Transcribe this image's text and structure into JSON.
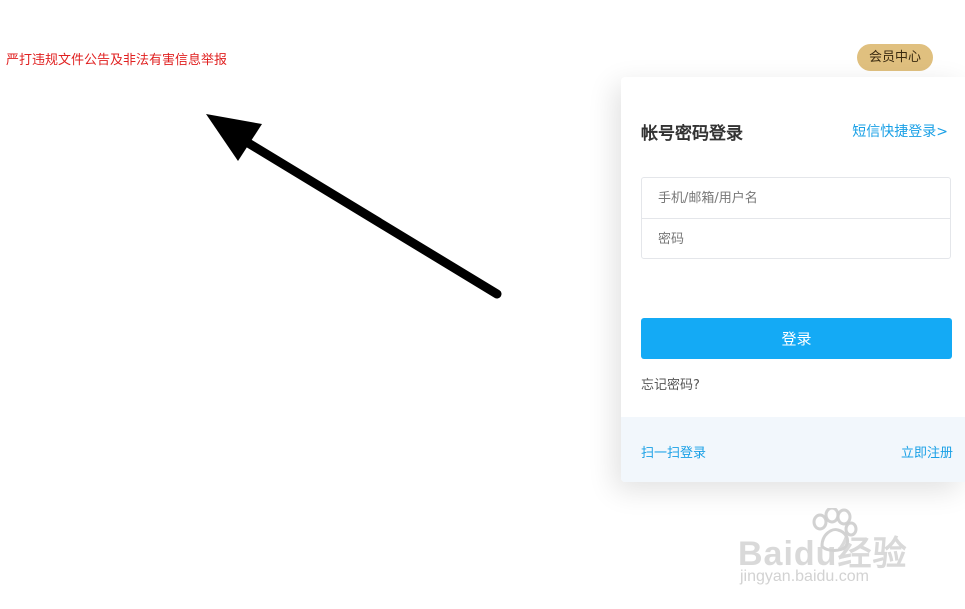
{
  "top": {
    "notice_link": "严打违规文件公告及非法有害信息举报",
    "member_center": "会员中心"
  },
  "login": {
    "title": "帐号密码登录",
    "sms_login": "短信快捷登录>",
    "username_placeholder": "手机/邮箱/用户名",
    "password_placeholder": "密码",
    "submit_label": "登录",
    "forgot_password": "忘记密码?",
    "scan_login": "扫一扫登录",
    "register": "立即注册"
  },
  "watermark": {
    "brand": "Baidu经验",
    "site": "jingyan.baidu.com"
  },
  "colors": {
    "notice_red": "#e02020",
    "link_blue": "#1aa0e6",
    "button_blue": "#14aaf5",
    "member_gold": "#e0c07f",
    "footer_bg": "#f2f7fc"
  }
}
